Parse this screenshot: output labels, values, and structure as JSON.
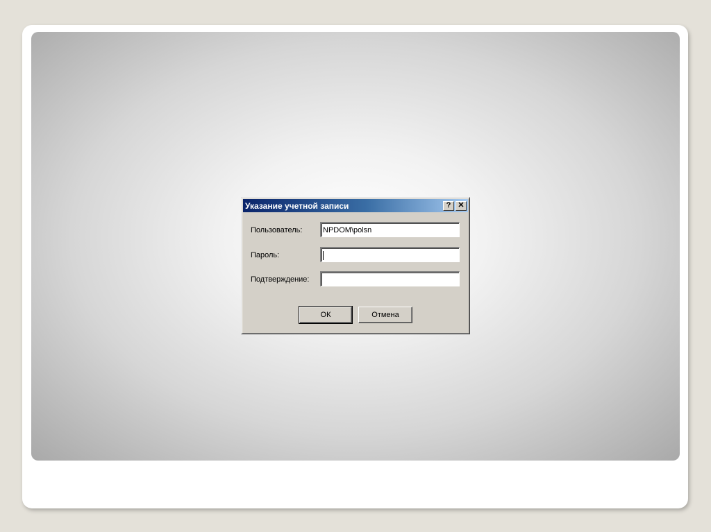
{
  "dialog": {
    "title": "Указание учетной записи",
    "help_button": "?",
    "close_button": "✕",
    "fields": [
      {
        "label": "Пользователь:",
        "value": "NPDOM\\polsn"
      },
      {
        "label": "Пароль:",
        "value": ""
      },
      {
        "label": "Подтверждение:",
        "value": ""
      }
    ],
    "ok_label": "ОК",
    "cancel_label": "Отмена"
  }
}
